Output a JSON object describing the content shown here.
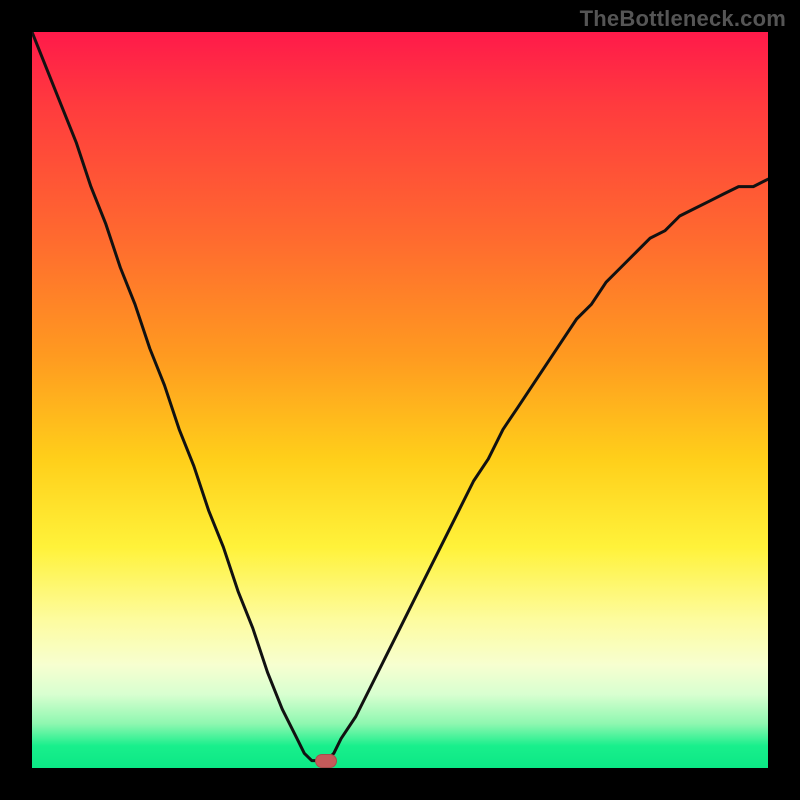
{
  "watermark": "TheBottleneck.com",
  "colors": {
    "frame": "#000000",
    "marker": "#c55a5a",
    "curve_stroke": "#111111",
    "gradient_stops": [
      "#ff1a4a",
      "#ff3b3e",
      "#ff6a2f",
      "#ff9a20",
      "#ffcf1a",
      "#fff23a",
      "#fdfca0",
      "#f7ffd0",
      "#d8ffd0",
      "#8ef7b0",
      "#19ef8c",
      "#0be885"
    ]
  },
  "chart_data": {
    "type": "line",
    "title": "",
    "xlabel": "",
    "ylabel": "",
    "xlim": [
      0,
      100
    ],
    "ylim": [
      0,
      100
    ],
    "grid": false,
    "x": [
      0,
      2,
      4,
      6,
      8,
      10,
      12,
      14,
      16,
      18,
      20,
      22,
      24,
      26,
      28,
      30,
      32,
      34,
      36,
      37,
      38,
      39,
      40,
      41,
      42,
      44,
      46,
      48,
      50,
      52,
      54,
      56,
      58,
      60,
      62,
      64,
      66,
      68,
      70,
      72,
      74,
      76,
      78,
      80,
      82,
      84,
      86,
      88,
      90,
      92,
      94,
      96,
      98,
      100
    ],
    "values": [
      100,
      95,
      90,
      85,
      79,
      74,
      68,
      63,
      57,
      52,
      46,
      41,
      35,
      30,
      24,
      19,
      13,
      8,
      4,
      2,
      1,
      1,
      1,
      2,
      4,
      7,
      11,
      15,
      19,
      23,
      27,
      31,
      35,
      39,
      42,
      46,
      49,
      52,
      55,
      58,
      61,
      63,
      66,
      68,
      70,
      72,
      73,
      75,
      76,
      77,
      78,
      79,
      79,
      80
    ],
    "marker": {
      "x": 40,
      "y": 1
    },
    "note": "Axis is inverted visually: y=0 at bottom, y=100 at top; curve forms a V with minimum near x≈40."
  }
}
